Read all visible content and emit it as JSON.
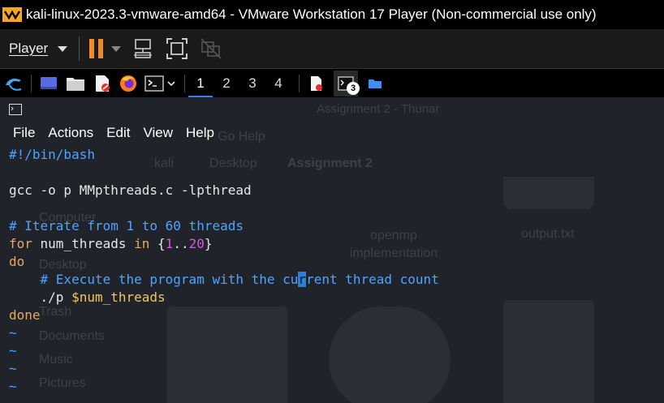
{
  "window": {
    "title": "kali-linux-2023.3-vmware-amd64 - VMware Workstation 17 Player (Non-commercial use only)"
  },
  "player_toolbar": {
    "player_menu_label": "Player",
    "buttons": [
      "pause-icon",
      "send-ctrl-alt-del-icon",
      "fit-guest-icon",
      "unity-icon"
    ],
    "pause_color": "#f08a24"
  },
  "kali_panel": {
    "launchers": [
      "kali-menu-icon",
      "show-desktop-icon",
      "file-manager-icon",
      "text-editor-icon",
      "firefox-icon",
      "terminal-icon"
    ],
    "workspaces": [
      "1",
      "2",
      "3",
      "4"
    ],
    "active_workspace": "1",
    "taskbar_badge": "3",
    "accent": "#367bf0"
  },
  "terminal": {
    "menu": [
      "File",
      "Actions",
      "Edit",
      "View",
      "Help"
    ],
    "code": {
      "shebang": "#!/bin/bash",
      "compile_cmd": "gcc -o p MMpthreads.c -lpthread",
      "comment1": "# Iterate from 1 to 60 threads",
      "for_kw": "for",
      "for_var": " num_threads ",
      "in_kw": "in",
      "brace_open": " {",
      "range_start": "1",
      "range_sep": "..",
      "range_end": "20",
      "brace_close": "}",
      "do_kw": "do",
      "comment2_pre": "    # Execute the program with the cu",
      "comment2_cursor": "r",
      "comment2_post": "rent thread count",
      "run_cmd": "    ./p ",
      "run_var": "$num_threads",
      "done_kw": "done",
      "tilde": "~"
    }
  },
  "background_window": {
    "title": "Assignment 2 - Thunar",
    "menu_fragment": "Go   Help",
    "path": [
      "kali",
      "Desktop",
      "Assignment 2"
    ],
    "files": [
      "openmp implementation",
      "output.txt"
    ],
    "sidebar": [
      "Computer",
      "Desktop",
      "Trash",
      "Documents",
      "Music",
      "Pictures"
    ]
  }
}
